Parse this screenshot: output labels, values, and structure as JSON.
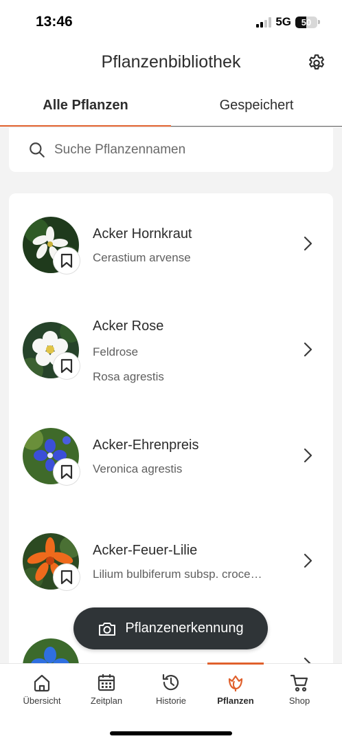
{
  "status_bar": {
    "time": "13:46",
    "network": "5G",
    "battery": "50",
    "battery_level": 0.5
  },
  "header": {
    "title": "Pflanzenbibliothek",
    "settings_icon": "gear-icon"
  },
  "tabs": [
    {
      "label": "Alle Pflanzen",
      "active": true
    },
    {
      "label": "Gespeichert",
      "active": false
    }
  ],
  "search": {
    "placeholder": "Suche Pflanzennamen",
    "value": ""
  },
  "plants": [
    {
      "name": "Acker Hornkraut",
      "subtitles": [
        "Cerastium arvense"
      ]
    },
    {
      "name": "Acker Rose",
      "subtitles": [
        "Feldrose",
        "Rosa agrestis"
      ]
    },
    {
      "name": "Acker-Ehrenpreis",
      "subtitles": [
        "Veronica agrestis"
      ]
    },
    {
      "name": "Acker-Feuer-Lilie",
      "subtitles": [
        "Lilium bulbiferum subsp. croce…"
      ]
    }
  ],
  "fab": {
    "label": "Pflanzenerkennung",
    "icon": "camera-icon"
  },
  "bottom_nav": [
    {
      "label": "Übersicht",
      "icon": "home-icon",
      "active": false
    },
    {
      "label": "Zeitplan",
      "icon": "calendar-icon",
      "active": false
    },
    {
      "label": "Historie",
      "icon": "history-icon",
      "active": false
    },
    {
      "label": "Pflanzen",
      "icon": "tulip-icon",
      "active": true
    },
    {
      "label": "Shop",
      "icon": "cart-icon",
      "active": false
    }
  ],
  "colors": {
    "accent": "#e0602c",
    "fab_background": "#2f3437",
    "page_background": "#f3f3f3"
  }
}
